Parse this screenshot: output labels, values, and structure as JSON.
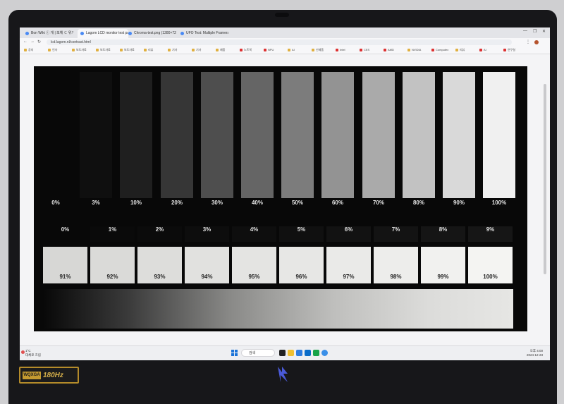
{
  "browser": {
    "tabs": [
      {
        "label": "Bon Wiki ⓘ 개 | 보헤 ㄷ 위기"
      },
      {
        "label": "Lagom LCD monitor test page"
      },
      {
        "label": "Chroma-test.png (1280×720)"
      },
      {
        "label": "UFO Test: Multiple Framerates"
      }
    ],
    "url": "lcd.lagom.nl/contrast.html",
    "bookmarks": [
      {
        "label": "공지",
        "red": false
      },
      {
        "label": "인사",
        "red": false
      },
      {
        "label": "보도자료",
        "red": false
      },
      {
        "label": "보도자료",
        "red": false
      },
      {
        "label": "보도자료",
        "red": false
      },
      {
        "label": "리뷰",
        "red": false
      },
      {
        "label": "기사",
        "red": false
      },
      {
        "label": "기사",
        "red": false
      },
      {
        "label": "제품",
        "red": false
      },
      {
        "label": "노트북",
        "red": true
      },
      {
        "label": "NPU",
        "red": true
      },
      {
        "label": "AI",
        "red": false
      },
      {
        "label": "신제품",
        "red": false
      },
      {
        "label": "Intel",
        "red": true
      },
      {
        "label": "CES",
        "red": true
      },
      {
        "label": "AMD",
        "red": true
      },
      {
        "label": "NVIDIA",
        "red": false
      },
      {
        "label": "Computex",
        "red": true
      },
      {
        "label": "리뷰",
        "red": false
      },
      {
        "label": "AI",
        "red": true
      },
      {
        "label": "연구실",
        "red": true
      }
    ]
  },
  "pattern": {
    "gray_bars": [
      {
        "label": "0%",
        "level": 0
      },
      {
        "label": "3%",
        "level": 3
      },
      {
        "label": "10%",
        "level": 10
      },
      {
        "label": "20%",
        "level": 20
      },
      {
        "label": "30%",
        "level": 30
      },
      {
        "label": "40%",
        "level": 40
      },
      {
        "label": "50%",
        "level": 50
      },
      {
        "label": "60%",
        "level": 60
      },
      {
        "label": "70%",
        "level": 70
      },
      {
        "label": "80%",
        "level": 80
      },
      {
        "label": "90%",
        "level": 90
      },
      {
        "label": "100%",
        "level": 100
      }
    ],
    "black_cells": [
      {
        "label": "0%",
        "level": 0
      },
      {
        "label": "1%",
        "level": 1
      },
      {
        "label": "2%",
        "level": 2
      },
      {
        "label": "3%",
        "level": 3
      },
      {
        "label": "4%",
        "level": 4
      },
      {
        "label": "5%",
        "level": 5
      },
      {
        "label": "6%",
        "level": 6
      },
      {
        "label": "7%",
        "level": 7
      },
      {
        "label": "8%",
        "level": 8
      },
      {
        "label": "9%",
        "level": 9
      }
    ],
    "white_cells": [
      {
        "label": "91%",
        "level": 91
      },
      {
        "label": "92%",
        "level": 92
      },
      {
        "label": "93%",
        "level": 93
      },
      {
        "label": "94%",
        "level": 94
      },
      {
        "label": "95%",
        "level": 95
      },
      {
        "label": "96%",
        "level": 96
      },
      {
        "label": "97%",
        "level": 97
      },
      {
        "label": "98%",
        "level": 98
      },
      {
        "label": "99%",
        "level": 99
      },
      {
        "label": "100%",
        "level": 100
      }
    ]
  },
  "taskbar": {
    "weather_temp": "1°C",
    "weather_desc": "대체로 흐림",
    "search_placeholder": "검색",
    "time": "오후 4:00",
    "date": "2024-12-23"
  },
  "sticker": {
    "resolution": "WQXGA",
    "refresh": "180Hz"
  }
}
